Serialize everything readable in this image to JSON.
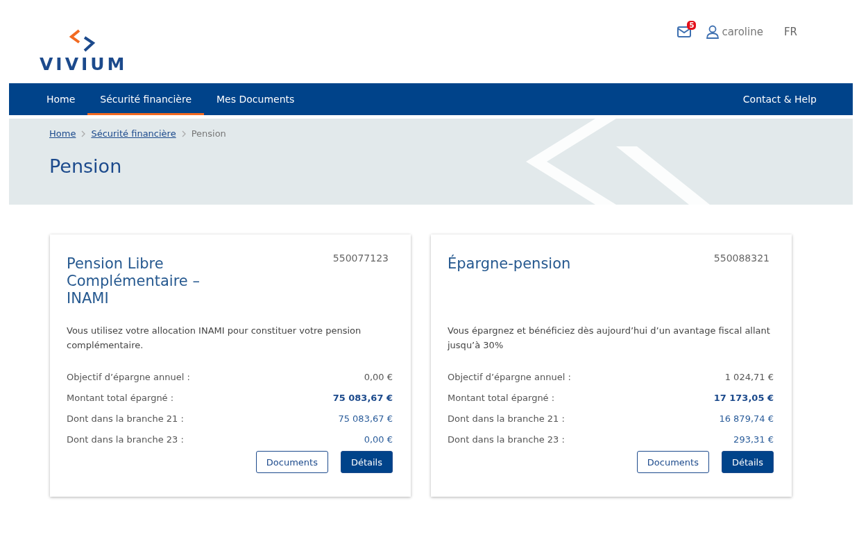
{
  "header": {
    "logo": "VIVIUM",
    "messages_badge": "5",
    "user": "caroline",
    "language": "FR"
  },
  "nav": {
    "items": [
      {
        "label": "Home",
        "selected": false
      },
      {
        "label": "Sécurité financière",
        "selected": true
      },
      {
        "label": "Mes Documents",
        "selected": false
      }
    ],
    "help": "Contact & Help"
  },
  "breadcrumb": [
    {
      "label": "Home",
      "link": true
    },
    {
      "label": "Sécurité financière",
      "link": true
    },
    {
      "label": "Pension",
      "link": false
    }
  ],
  "page_title": "Pension",
  "cards": [
    {
      "title": "Pension Libre Complémentaire – INAMI",
      "number": "550077123",
      "description": "Vous utilisez votre allocation INAMI pour constituer votre pension complémentaire.",
      "rows": [
        {
          "kind": "goal",
          "label": "Objectif d’épargne annuel :",
          "value": "0,00 €"
        },
        {
          "kind": "total",
          "label": "Montant total épargné :",
          "value": "75 083,67 €"
        },
        {
          "kind": "branch",
          "label": "Dont dans la branche 21 :",
          "value": "75 083,67 €"
        },
        {
          "kind": "branch",
          "label": "Dont dans la branche 23 :",
          "value": "0,00 €"
        }
      ],
      "buttons": [
        "Documents",
        "Détails"
      ]
    },
    {
      "title": "Épargne-pension",
      "number": "550088321",
      "description": "Vous épargnez et bénéficiez dès aujourd’hui d’un avantage fiscal allant jusqu’à 30%",
      "rows": [
        {
          "kind": "goal",
          "label": "Objectif d’épargne annuel :",
          "value": "1 024,71 €"
        },
        {
          "kind": "total",
          "label": "Montant total épargné :",
          "value": "17 173,05 €"
        },
        {
          "kind": "branch",
          "label": "Dont dans la branche 21 :",
          "value": "16 879,74 €"
        },
        {
          "kind": "branch",
          "label": "Dont dans la branche 23 :",
          "value": "293,31 €"
        }
      ],
      "buttons": [
        "Documents",
        "Détails"
      ]
    }
  ]
}
